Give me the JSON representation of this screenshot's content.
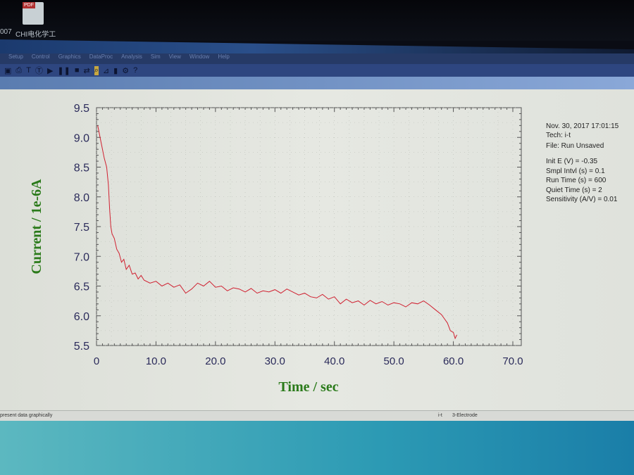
{
  "desktop": {
    "icons": [
      {
        "label": "007"
      },
      {
        "label": "CHI电化学工",
        "badge": "PDF"
      }
    ]
  },
  "menu": [
    "Setup",
    "Control",
    "Graphics",
    "DataProc",
    "Analysis",
    "Sim",
    "View",
    "Window",
    "Help"
  ],
  "toolbar_icons": [
    "save-icon",
    "print-icon",
    "text-icon",
    "text-box-icon",
    "run-icon",
    "pause-icon",
    "stop-icon",
    "reverse-icon",
    "zoom-icon",
    "graph-icon",
    "color-icon",
    "settings-icon",
    "help-icon"
  ],
  "info": {
    "date": "Nov. 30, 2017   17:01:15",
    "tech": "Tech: i-t",
    "file": "File: Run Unsaved",
    "params": [
      "Init E (V) = -0.35",
      "Smpl Intvl (s) = 0.1",
      "Run Time (s) = 600",
      "Quiet Time (s) = 2",
      "Sensitivity (A/V) = 0.01"
    ]
  },
  "status": {
    "left": "present data graphically",
    "tech": "i-t",
    "mode": "3-Electrode"
  },
  "chart_data": {
    "type": "line",
    "xlabel": "Time / sec",
    "ylabel": "Current / 1e-6A",
    "xlim": [
      0,
      70
    ],
    "ylim": [
      5.5,
      9.5
    ],
    "xticks": [
      "0",
      "10.0",
      "20.0",
      "30.0",
      "40.0",
      "50.0",
      "60.0",
      "70.0"
    ],
    "yticks": [
      "5.5",
      "6.0",
      "6.5",
      "7.0",
      "7.5",
      "8.0",
      "8.5",
      "9.0",
      "9.5"
    ],
    "grid": true,
    "line_color": "#d02030",
    "label_color": "#2a7a1a",
    "tick_color": "#2a2a5a",
    "x": [
      0.2,
      0.5,
      0.9,
      1.3,
      1.7,
      2.0,
      2.2,
      2.4,
      2.6,
      3.0,
      3.4,
      3.8,
      4.2,
      4.6,
      5.0,
      5.5,
      6.0,
      6.5,
      7.0,
      7.5,
      8.0,
      9.0,
      10.0,
      11.0,
      12.0,
      13.0,
      14.0,
      15.0,
      16.0,
      17.0,
      18.0,
      19.0,
      20.0,
      21.0,
      22.0,
      23.0,
      24.0,
      25.0,
      26.0,
      27.0,
      28.0,
      29.0,
      30.0,
      31.0,
      32.0,
      33.0,
      34.0,
      35.0,
      36.0,
      37.0,
      38.0,
      39.0,
      40.0,
      41.0,
      42.0,
      43.0,
      44.0,
      45.0,
      46.0,
      47.0,
      48.0,
      49.0,
      50.0,
      51.0,
      52.0,
      53.0,
      54.0,
      55.0,
      56.0,
      57.0,
      58.0,
      58.5,
      59.0,
      59.5,
      60.0,
      60.3,
      60.6
    ],
    "y": [
      9.2,
      9.05,
      8.85,
      8.65,
      8.5,
      8.2,
      7.8,
      7.5,
      7.38,
      7.3,
      7.12,
      7.05,
      6.9,
      6.95,
      6.78,
      6.85,
      6.7,
      6.72,
      6.62,
      6.68,
      6.6,
      6.55,
      6.58,
      6.5,
      6.55,
      6.48,
      6.52,
      6.38,
      6.45,
      6.55,
      6.5,
      6.58,
      6.48,
      6.5,
      6.42,
      6.47,
      6.45,
      6.4,
      6.46,
      6.38,
      6.42,
      6.4,
      6.44,
      6.38,
      6.45,
      6.4,
      6.35,
      6.38,
      6.32,
      6.3,
      6.36,
      6.28,
      6.32,
      6.2,
      6.28,
      6.22,
      6.25,
      6.18,
      6.26,
      6.2,
      6.24,
      6.18,
      6.22,
      6.2,
      6.15,
      6.22,
      6.2,
      6.25,
      6.18,
      6.1,
      6.02,
      5.95,
      5.88,
      5.75,
      5.72,
      5.62,
      5.68
    ]
  }
}
